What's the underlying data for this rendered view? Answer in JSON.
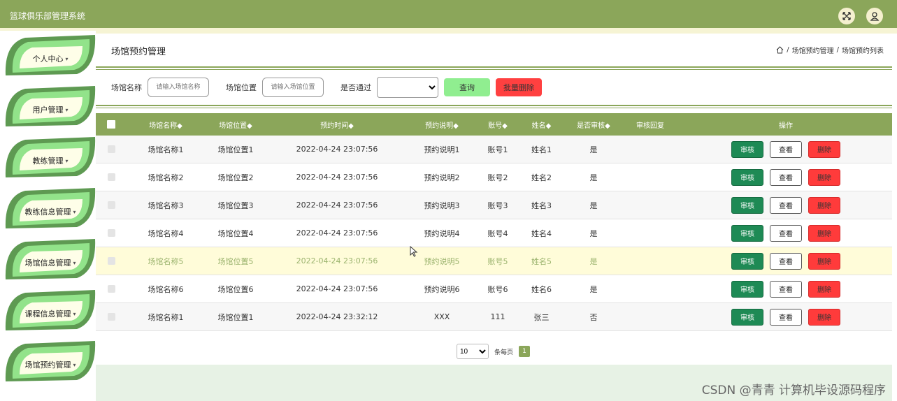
{
  "app": {
    "title": "篮球俱乐部管理系统"
  },
  "header": {
    "fullscreen_icon": "fullscreen-icon",
    "user_icon": "user-icon"
  },
  "sidebar": {
    "items": [
      {
        "label": "个人中心"
      },
      {
        "label": "用户管理"
      },
      {
        "label": "教练管理"
      },
      {
        "label": "教练信息管理"
      },
      {
        "label": "场馆信息管理"
      },
      {
        "label": "课程信息管理"
      },
      {
        "label": "场馆预约管理"
      }
    ],
    "caret": "▾"
  },
  "page": {
    "title": "场馆预约管理",
    "breadcrumb": {
      "home_icon": "home-icon",
      "sep": "/",
      "level1": "场馆预约管理",
      "level2": "场馆预约列表"
    }
  },
  "search": {
    "name_label": "场馆名称",
    "name_placeholder": "请输入场馆名称",
    "location_label": "场馆位置",
    "location_placeholder": "请输入场馆位置",
    "approved_label": "是否通过",
    "approved_value": "",
    "query_button": "查询",
    "batch_delete_button": "批量删除"
  },
  "table": {
    "headers": [
      "场馆名称◆",
      "场馆位置◆",
      "预约时间◆",
      "预约说明◆",
      "账号◆",
      "姓名◆",
      "是否审核◆",
      "审核回复",
      "操作"
    ],
    "rows": [
      {
        "name": "场馆名称1",
        "location": "场馆位置1",
        "time": "2022-04-24 23:07:56",
        "note": "预约说明1",
        "account": "账号1",
        "person": "姓名1",
        "approved": "是",
        "reply": ""
      },
      {
        "name": "场馆名称2",
        "location": "场馆位置2",
        "time": "2022-04-24 23:07:56",
        "note": "预约说明2",
        "account": "账号2",
        "person": "姓名2",
        "approved": "是",
        "reply": ""
      },
      {
        "name": "场馆名称3",
        "location": "场馆位置3",
        "time": "2022-04-24 23:07:56",
        "note": "预约说明3",
        "account": "账号3",
        "person": "姓名3",
        "approved": "是",
        "reply": ""
      },
      {
        "name": "场馆名称4",
        "location": "场馆位置4",
        "time": "2022-04-24 23:07:56",
        "note": "预约说明4",
        "account": "账号4",
        "person": "姓名4",
        "approved": "是",
        "reply": ""
      },
      {
        "name": "场馆名称5",
        "location": "场馆位置5",
        "time": "2022-04-24 23:07:56",
        "note": "预约说明5",
        "account": "账号5",
        "person": "姓名5",
        "approved": "是",
        "reply": ""
      },
      {
        "name": "场馆名称6",
        "location": "场馆位置6",
        "time": "2022-04-24 23:07:56",
        "note": "预约说明6",
        "account": "账号6",
        "person": "姓名6",
        "approved": "是",
        "reply": ""
      },
      {
        "name": "场馆名称1",
        "location": "场馆位置1",
        "time": "2022-04-24 23:32:12",
        "note": "XXX",
        "account": "111",
        "person": "张三",
        "approved": "否",
        "reply": ""
      }
    ],
    "actions": {
      "audit": "审核",
      "view": "查看",
      "delete": "删除"
    }
  },
  "pagination": {
    "page_size": "10",
    "per_page_label": "条每页",
    "current_page": "1"
  },
  "watermark": "CSDN @青青  计算机毕设源码程序",
  "colors": {
    "header": "#8ba65a",
    "leaf_dark": "#5e9a52",
    "leaf_light": "#92e38a",
    "query": "#90ee90",
    "delete": "#ff4040",
    "audit": "#1e8a55"
  }
}
